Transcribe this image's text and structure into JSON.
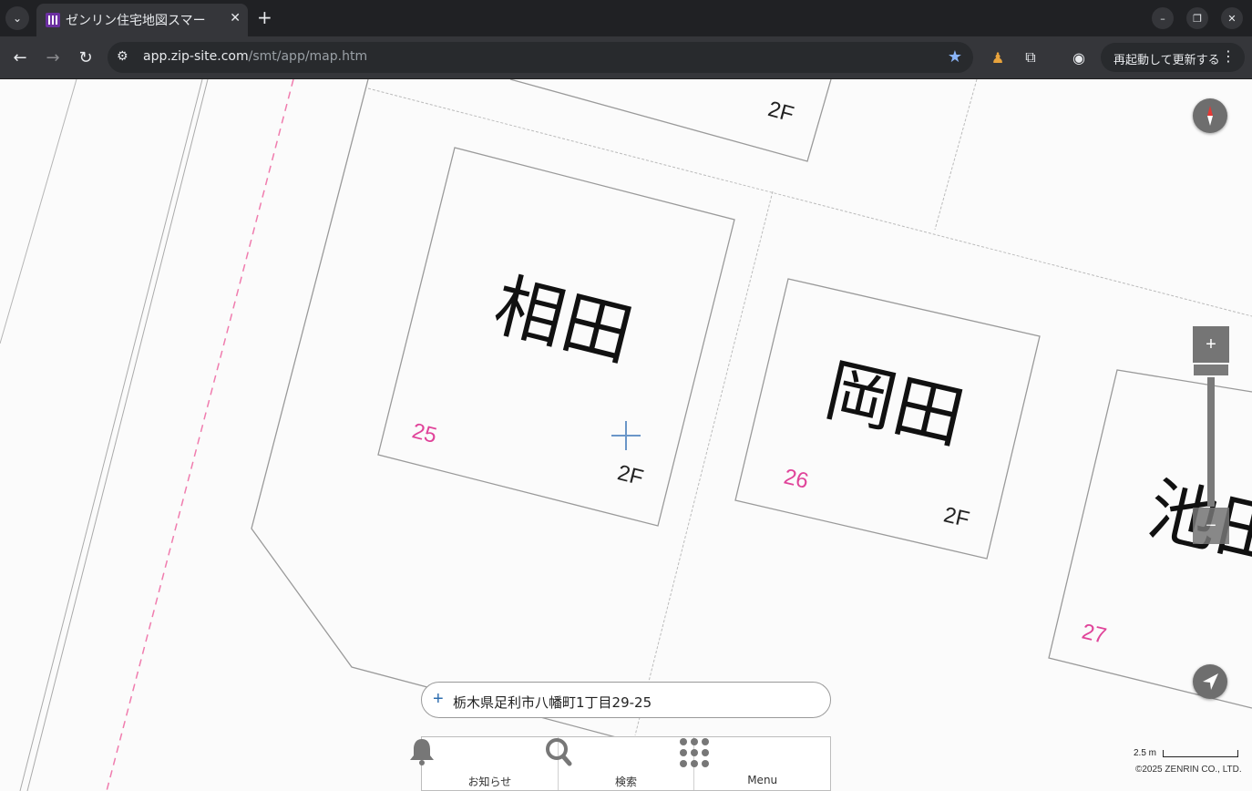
{
  "browser": {
    "tab_title": "ゼンリン住宅地図スマー",
    "url_host": "app.zip-site.com",
    "url_path": "/smt/app/map.htm",
    "update_button_label": "再起動して更新する"
  },
  "map": {
    "buildings": [
      {
        "name": "相田",
        "lot": "25",
        "floors": "2F"
      },
      {
        "name": "岡田",
        "lot": "26",
        "floors": "2F"
      },
      {
        "name": "池田",
        "lot": "27",
        "floors": ""
      }
    ],
    "top_building_floors": "2F",
    "address": "栃木県足利市八幡町1丁目29-25",
    "scale_label": "2.5 m",
    "copyright": "©2025 ZENRIN CO., LTD."
  },
  "bottom_menu": [
    {
      "label": "お知らせ",
      "icon": "bell-icon"
    },
    {
      "label": "検索",
      "icon": "search-icon"
    },
    {
      "label": "Menu",
      "icon": "grid-menu-icon"
    }
  ],
  "colors": {
    "lot_number": "#e0449a",
    "boundary_dashed": "#f07cae",
    "building_outline": "#9a9a9a",
    "controls": "#757575"
  }
}
